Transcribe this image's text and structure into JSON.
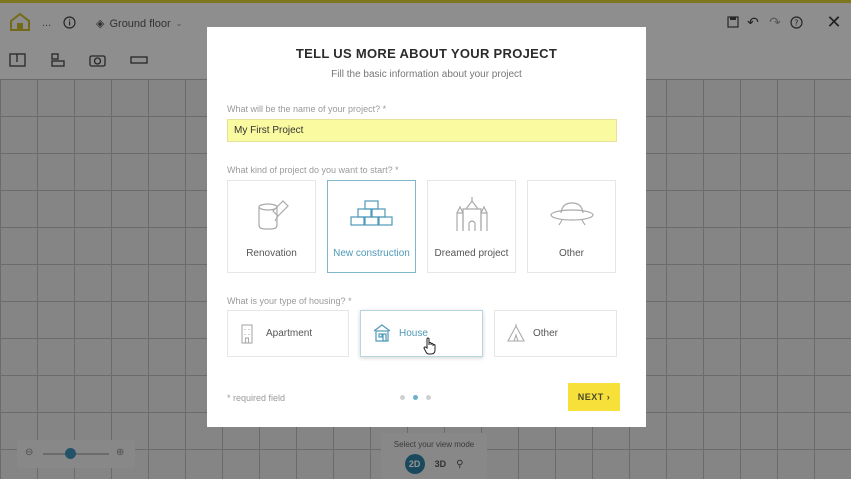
{
  "app": {
    "breadcrumb_dots": "...",
    "floor_selector": "Ground floor",
    "view_mode_title": "Select your view mode",
    "view_modes": [
      "2D",
      "3D"
    ],
    "active_view_mode": "2D"
  },
  "modal": {
    "title": "TELL US MORE ABOUT YOUR PROJECT",
    "subtitle": "Fill the basic information about your project",
    "name_label": "What will be the name of your project? *",
    "name_value": "My First Project",
    "kind_label": "What kind of project do you want to start? *",
    "project_types": [
      {
        "label": "Renovation",
        "icon": "paint-bucket-icon",
        "selected": false
      },
      {
        "label": "New construction",
        "icon": "bricks-icon",
        "selected": true
      },
      {
        "label": "Dreamed project",
        "icon": "castle-icon",
        "selected": false
      },
      {
        "label": "Other",
        "icon": "ufo-icon",
        "selected": false
      }
    ],
    "housing_label": "What is your type of housing? *",
    "housing_types": [
      {
        "label": "Apartment",
        "icon": "building-icon",
        "selected": false
      },
      {
        "label": "House",
        "icon": "house-icon",
        "selected": true
      },
      {
        "label": "Other",
        "icon": "tent-icon",
        "selected": false
      }
    ],
    "required_note": "* required field",
    "pager": {
      "total": 3,
      "current": 2
    },
    "next_label": "NEXT"
  },
  "colors": {
    "accent_yellow": "#f7e03a",
    "selected_blue": "#4e99b8",
    "input_yellow": "#fafaa0"
  }
}
